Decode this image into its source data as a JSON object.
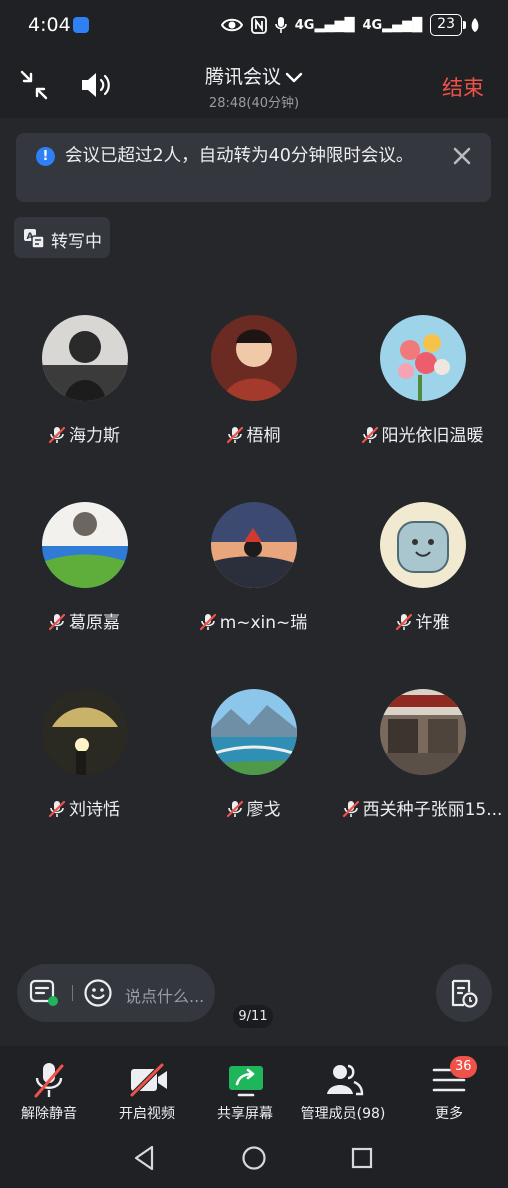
{
  "status_bar": {
    "time": "4:04",
    "icons": [
      "meeting-app-icon",
      "eye-icon",
      "nfc-icon",
      "mic-icon",
      "signal-4g-icon",
      "signal-4g-icon",
      "leaf-icon"
    ],
    "net1": "4G",
    "net2": "4G",
    "battery": "23"
  },
  "header": {
    "title": "腾讯会议",
    "timer": "28:48(40分钟)",
    "end_label": "结束"
  },
  "notice": {
    "text": "会议已超过2人，自动转为40分钟限时会议。",
    "icon": "info-icon"
  },
  "transcribe": {
    "label": "转写中"
  },
  "participants": [
    {
      "name": "海力斯",
      "muted": true
    },
    {
      "name": "梧桐",
      "muted": true
    },
    {
      "name": "阳光依旧温暖",
      "muted": true
    },
    {
      "name": "葛原嘉",
      "muted": true
    },
    {
      "name": "m~xin~瑞",
      "muted": true
    },
    {
      "name": "许雅",
      "muted": true
    },
    {
      "name": "刘诗恬",
      "muted": true
    },
    {
      "name": "廖戈",
      "muted": true
    },
    {
      "name": "西关种子张丽15...",
      "muted": true
    }
  ],
  "chat": {
    "placeholder": "说点什么..."
  },
  "pager": "9/11",
  "toolbar": {
    "unmute": "解除静音",
    "video": "开启视频",
    "share": "共享屏幕",
    "members": "管理成员(98)",
    "more": "更多",
    "more_badge": "36"
  },
  "colors": {
    "background": "#25272b",
    "accent_blue": "#2f7ff5",
    "end_red": "#f0524a",
    "share_green": "#1fb55b"
  }
}
